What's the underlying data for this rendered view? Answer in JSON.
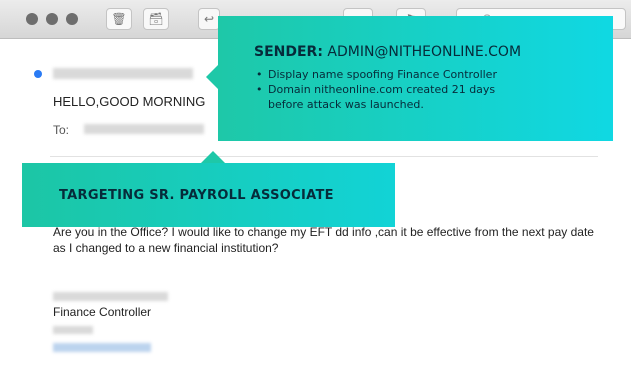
{
  "toolbar": {
    "window_controls": [
      "close",
      "minimize",
      "zoom"
    ],
    "buttons": [
      {
        "name": "trash-icon",
        "glyph": "🗑"
      },
      {
        "name": "archive-icon",
        "glyph": "🗃"
      },
      {
        "name": "reply-icon",
        "glyph": "↩"
      },
      {
        "name": "folder-icon",
        "glyph": "▭"
      },
      {
        "name": "flag-icon",
        "glyph": "⚑"
      }
    ],
    "search_placeholder": "Se"
  },
  "message": {
    "subject": "HELLO,GOOD MORNING",
    "to_label": "To:",
    "body": "Are you in the Office? I would like to change my EFT dd info ,can it be effective from the next pay date as I changed to a new financial institution?",
    "signature_title": "Finance Controller"
  },
  "callouts": {
    "sender": {
      "label": "SENDER:",
      "value": "ADMIN@NITHEONLINE.COM",
      "bullets": [
        "Display name spoofing Finance Controller",
        "Domain nitheonline.com created 21 days",
        "before attack was launched."
      ]
    },
    "target": {
      "text": "TARGETING SR. PAYROLL ASSOCIATE"
    }
  },
  "colors": {
    "callout_start": "#1ec8a8",
    "callout_end": "#10d8e3",
    "callout_text": "#062b3a",
    "unread_dot": "#2a7bf4"
  }
}
